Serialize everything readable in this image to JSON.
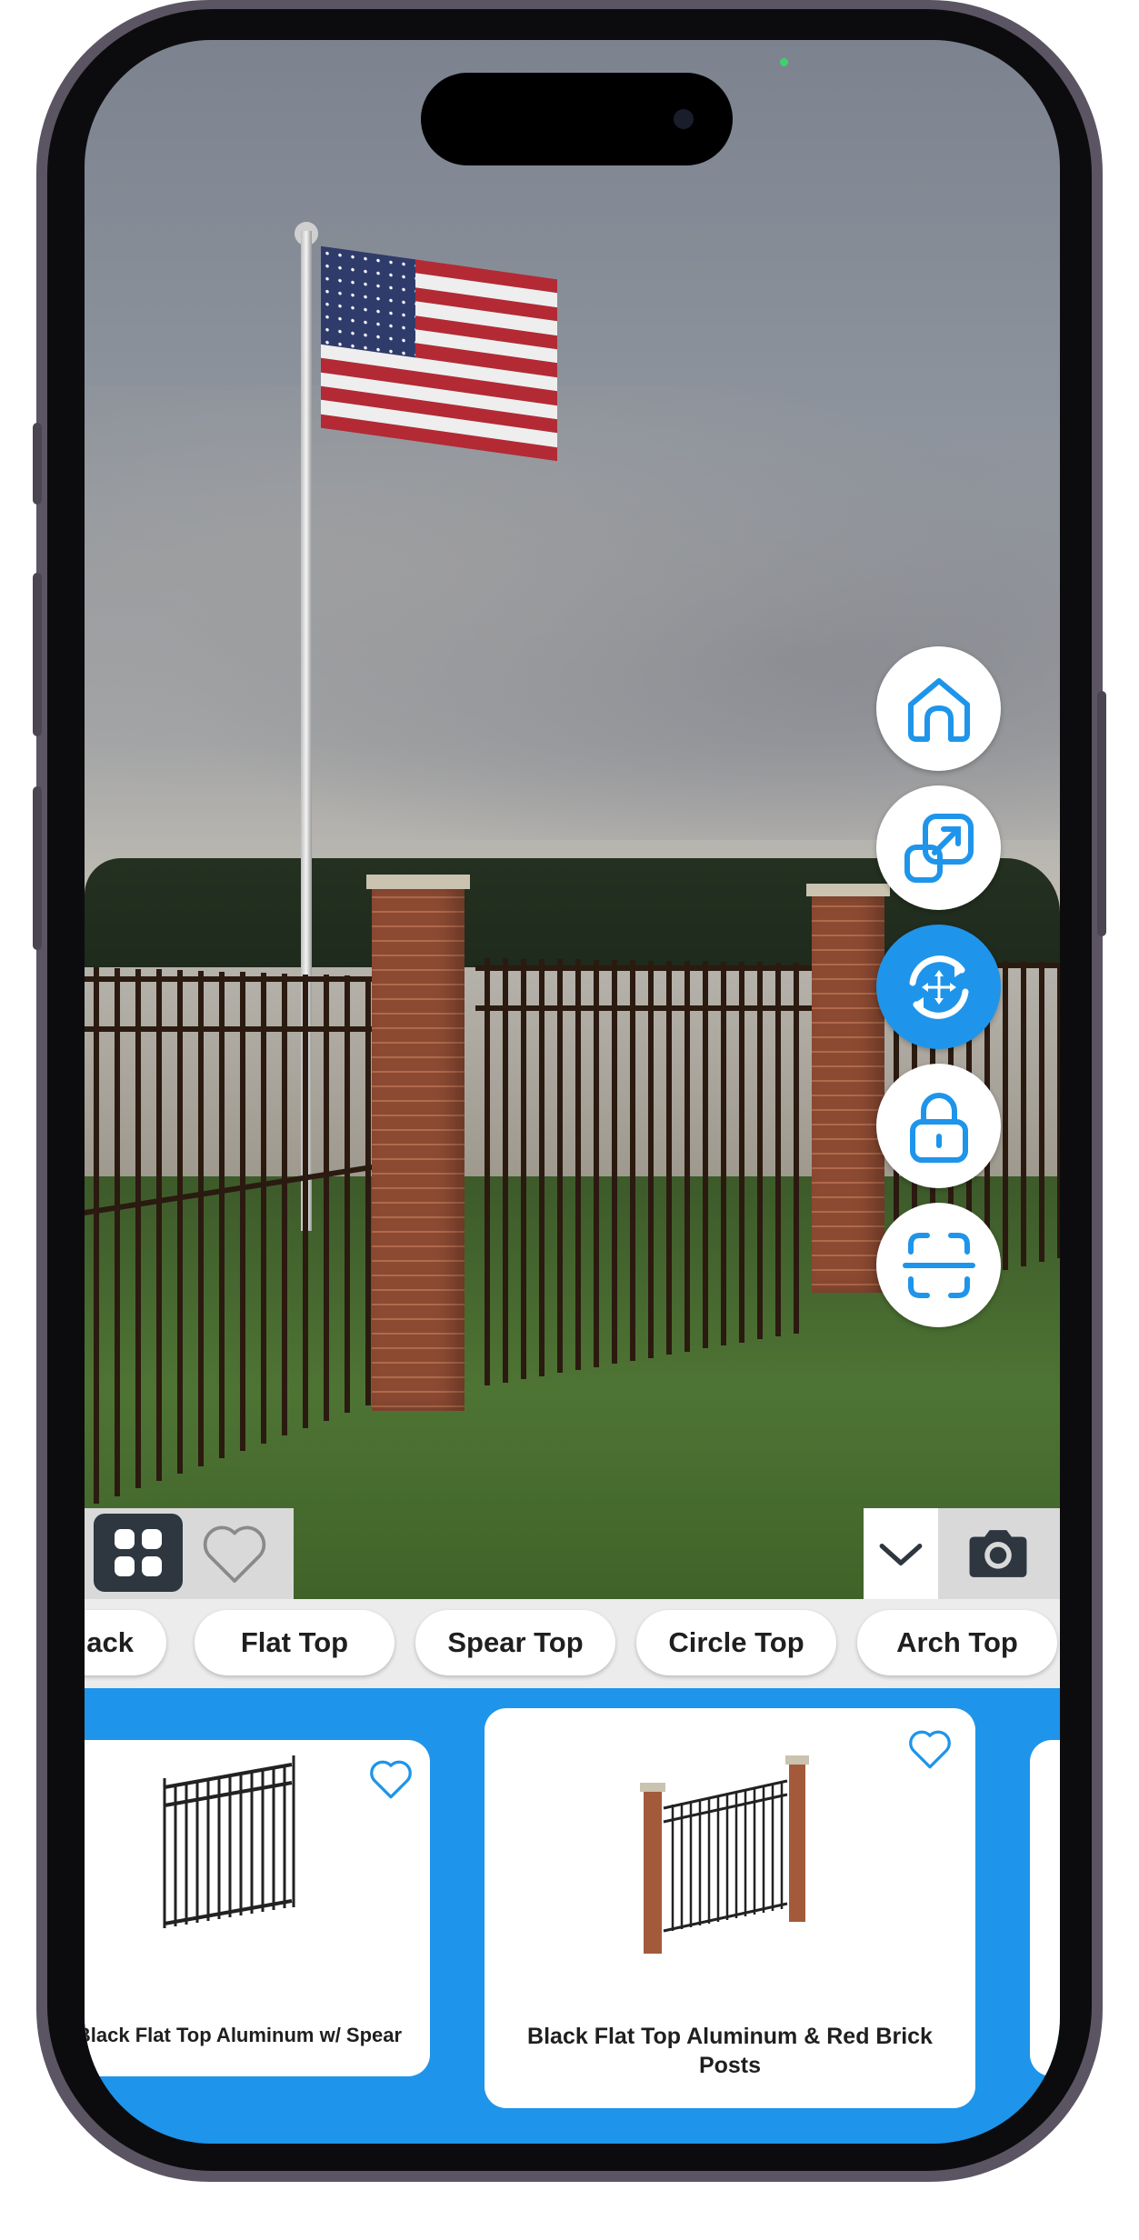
{
  "style_chips": [
    "Black",
    "Flat Top",
    "Spear Top",
    "Circle Top",
    "Arch Top"
  ],
  "side_tools": [
    "home-icon",
    "resize-icon",
    "rotate-move-icon",
    "lock-icon",
    "scan-icon"
  ],
  "toolbar": {
    "left": [
      "grid-icon",
      "heart-icon"
    ],
    "right": [
      "chevron-down-icon",
      "camera-icon"
    ]
  },
  "products": [
    {
      "name": "Black Flat Top Aluminum w/ Spear",
      "favorite": false
    },
    {
      "name": "Black Flat Top Aluminum & Red Brick Posts",
      "favorite": false
    }
  ],
  "colors": {
    "accent": "#1e95ea",
    "dark": "#2e3640"
  }
}
